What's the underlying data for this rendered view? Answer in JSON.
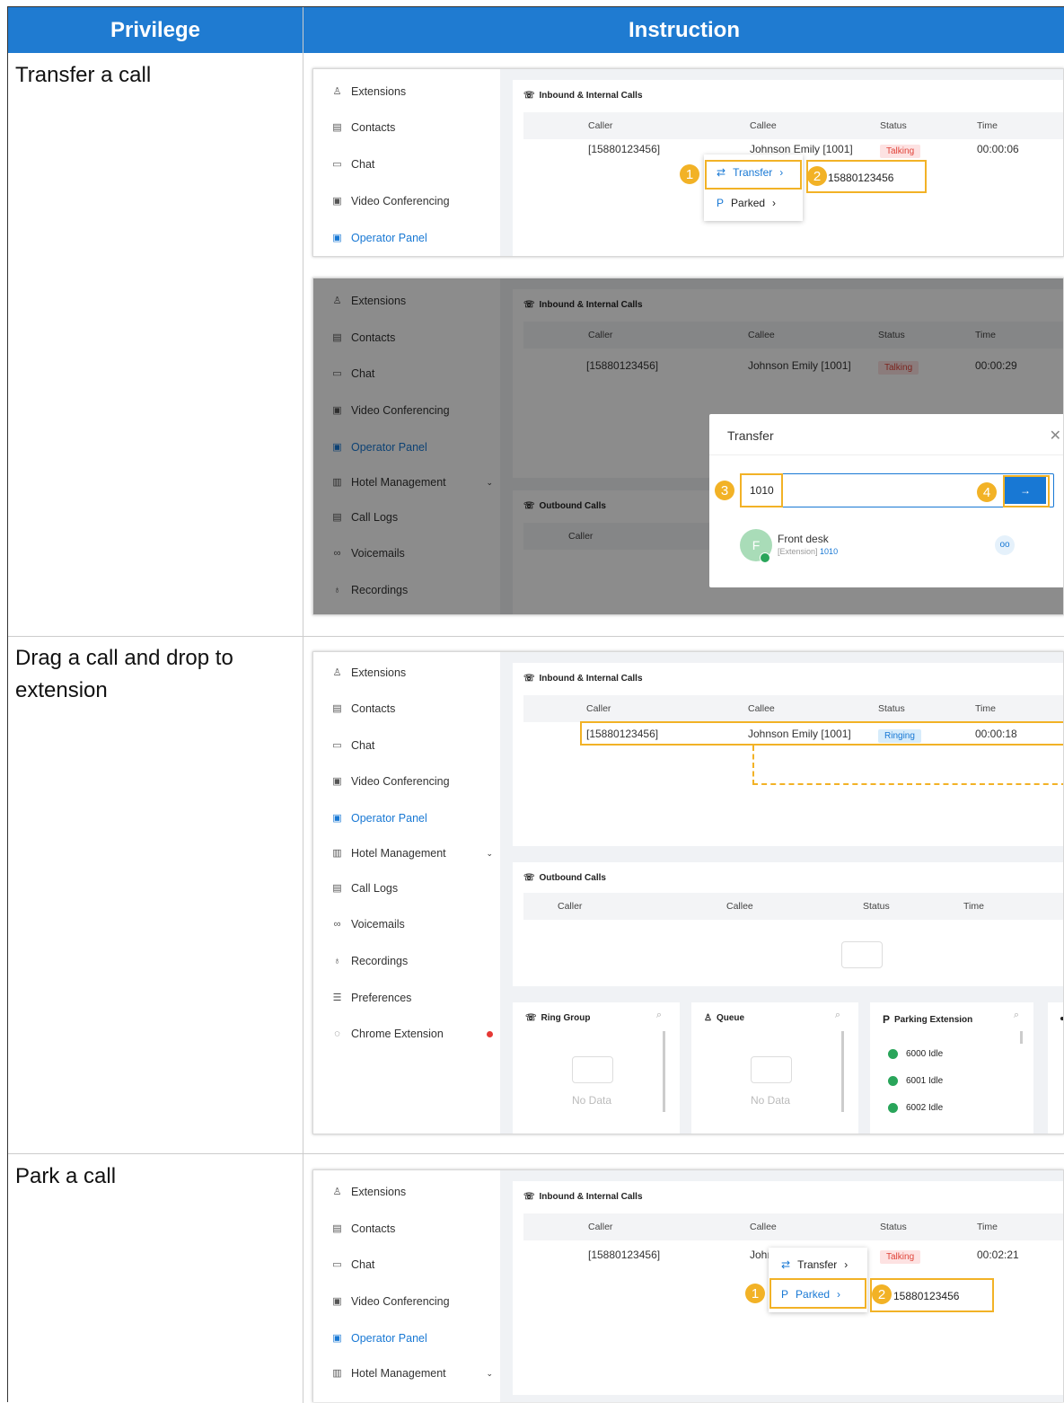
{
  "table": {
    "header_privilege": "Privilege",
    "header_instruction": "Instruction",
    "rows": [
      {
        "privilege": "Transfer a call"
      },
      {
        "privilege": "Drag a call and drop to extension"
      },
      {
        "privilege": "Park a call"
      }
    ]
  },
  "sidebar": {
    "extensions": "Extensions",
    "contacts": "Contacts",
    "chat": "Chat",
    "video": "Video Conferencing",
    "operator": "Operator Panel",
    "hotel": "Hotel Management",
    "call_logs": "Call Logs",
    "voicemails": "Voicemails",
    "recordings": "Recordings",
    "preferences": "Preferences",
    "chrome": "Chrome Extension"
  },
  "calls": {
    "inbound_title": "Inbound & Internal Calls",
    "outbound_title": "Outbound Calls",
    "col_caller": "Caller",
    "col_callee": "Callee",
    "col_status": "Status",
    "col_time": "Time",
    "caller": "[15880123456]",
    "callee": "Johnson Emily [1001]",
    "callee_short": "Johı",
    "talking": "Talking",
    "ringing": "Ringing",
    "time1": "00:00:06",
    "time2": "00:00:29",
    "time3": "00:00:18",
    "time4": "00:02:21"
  },
  "menu": {
    "transfer": "Transfer",
    "parked": "Parked",
    "target_number": "15880123456"
  },
  "transfer_dialog": {
    "title": "Transfer",
    "input_value": "1010",
    "result_name": "Front desk",
    "result_type": "[Extension]",
    "result_number": "1010",
    "avatar_letter": "F"
  },
  "cards": {
    "ring_group": "Ring Group",
    "queue": "Queue",
    "parking": "Parking Extension",
    "no_data": "No Data",
    "park1": "6000 Idle",
    "park2": "6001 Idle",
    "park3": "6002 Idle"
  },
  "steps": {
    "s1": "1",
    "s2": "2",
    "s3": "3",
    "s4": "4"
  },
  "colors": {
    "header": "#1f7bd1",
    "highlight": "#f2b226",
    "link": "#1878d4",
    "talking": "#e0443a"
  }
}
